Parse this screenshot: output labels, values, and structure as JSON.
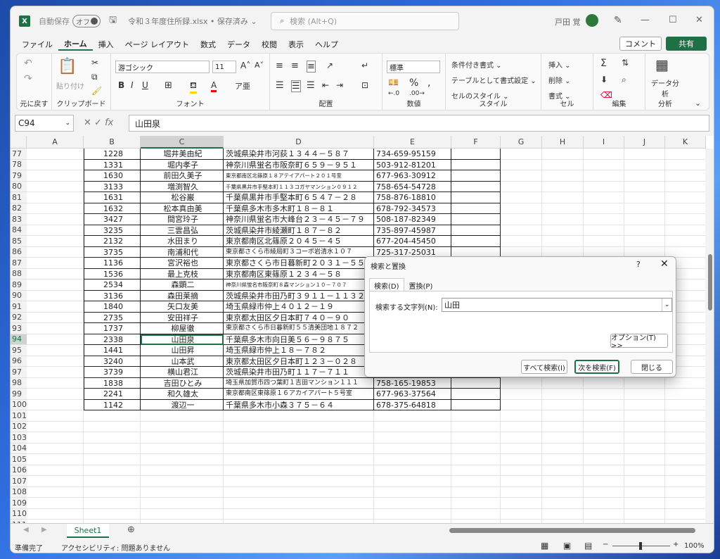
{
  "window": {
    "autosave_label": "自動保存",
    "autosave_state": "オフ",
    "doc_title": "令和３年度住所録.xlsx • 保存済み ⌄",
    "search_placeholder": "検索 (Alt+Q)",
    "user_name": "戸田 覚"
  },
  "menu": {
    "tabs": [
      "ファイル",
      "ホーム",
      "挿入",
      "ページ レイアウト",
      "数式",
      "データ",
      "校閲",
      "表示",
      "ヘルプ"
    ],
    "active": "ホーム",
    "comment": "コメント",
    "share": "共有"
  },
  "ribbon": {
    "undo_group": "元に戻す",
    "clipboard": "クリップボード",
    "paste": "貼り付け",
    "font": "フォント",
    "font_name": "游ゴシック",
    "font_size": "11",
    "alignment": "配置",
    "number": "数値",
    "number_format": "標準",
    "style": "スタイル",
    "cond_format": "条件付き書式 ⌄",
    "table_format": "テーブルとして書式設定 ⌄",
    "cell_style": "セルのスタイル ⌄",
    "cells": "セル",
    "insert": "挿入 ⌄",
    "delete": "削除 ⌄",
    "format": "書式 ⌄",
    "editing": "編集",
    "analysis": "分析",
    "data_analysis": "データ分析"
  },
  "formula_bar": {
    "name_box": "C94",
    "content": "山田泉"
  },
  "columns": [
    "A",
    "B",
    "C",
    "D",
    "E",
    "F",
    "G",
    "H",
    "I",
    "J",
    "K"
  ],
  "rows": [
    {
      "n": "77",
      "b": "1228",
      "c": "堀井美由紀",
      "d": "茨城県染井市河荻１３４４－５８７",
      "e": "734-659-95159"
    },
    {
      "n": "78",
      "b": "1331",
      "c": "堀内孝子",
      "d": "神奈川県蛍名市阪奈町６５９－９５１",
      "e": "503-912-81201"
    },
    {
      "n": "79",
      "b": "1630",
      "c": "前田久美子",
      "d": "東京都南区北篠原１８アテイアパート２０１号室",
      "e": "677-963-30912"
    },
    {
      "n": "80",
      "b": "3133",
      "c": "増渕智久",
      "d": "千葉県黒井市手堅本町１１３コガヤマンション０９１２",
      "e": "758-654-54728"
    },
    {
      "n": "81",
      "b": "1631",
      "c": "松谷巌",
      "d": "千葉県黒井市手堅本町６５４７－２８",
      "e": "758-876-18810"
    },
    {
      "n": "82",
      "b": "1632",
      "c": "松本真由美",
      "d": "千葉県多木市多木町１８－８１",
      "e": "678-792-34573"
    },
    {
      "n": "83",
      "b": "3427",
      "c": "間宮玲子",
      "d": "神奈川県蛍名市大峰台２３－４５－７９",
      "e": "508-187-82349"
    },
    {
      "n": "84",
      "b": "3235",
      "c": "三雲昌弘",
      "d": "茨城県染井市綾瀬町１８７－８２",
      "e": "735-897-45987"
    },
    {
      "n": "85",
      "b": "2132",
      "c": "水田まり",
      "d": "東京都南区北篠原２０４５－４５",
      "e": "677-204-45450"
    },
    {
      "n": "86",
      "b": "3735",
      "c": "南浦和代",
      "d": "東京都さくら市綾局町３コーポ岩清水１０７",
      "e": "725-317-25031"
    },
    {
      "n": "87",
      "b": "1136",
      "c": "宮沢裕也",
      "d": "東京都さくら市日暮新町２０３１－５５",
      "e": "5"
    },
    {
      "n": "88",
      "b": "1536",
      "c": "最上克枝",
      "d": "東京都南区東篠原１２３４－５８",
      "e": "6"
    },
    {
      "n": "89",
      "b": "2534",
      "c": "森顕二",
      "d": "神奈川県蛍名市阪奈町８森マンション１０－７０７",
      "e": "5"
    },
    {
      "n": "90",
      "b": "3136",
      "c": "森田莱摘",
      "d": "茨城県染井市田乃町３９１１－１１３２",
      "e": "7"
    },
    {
      "n": "91",
      "b": "1840",
      "c": "矢口友美",
      "d": "埼玉県緑市仲上４０１２－１９",
      "e": "7"
    },
    {
      "n": "92",
      "b": "2735",
      "c": "安田祥子",
      "d": "東京都太田区夕日本町７４０－９０",
      "e": "5"
    },
    {
      "n": "93",
      "b": "1737",
      "c": "柳屋徹",
      "d": "東京都さくら市日暮新町５５清美団地１８７２",
      "e": "7"
    },
    {
      "n": "94",
      "b": "2338",
      "c": "山田泉",
      "d": "千葉県多木市向日美５６－９８７５",
      "e": "6"
    },
    {
      "n": "95",
      "b": "1441",
      "c": "山田昇",
      "d": "埼玉県緑市仲上１８－７８２",
      "e": "7"
    },
    {
      "n": "96",
      "b": "3240",
      "c": "山本武",
      "d": "東京都太田区夕日本町１２３－０２８",
      "e": "5"
    },
    {
      "n": "97",
      "b": "3739",
      "c": "横山君江",
      "d": "茨城県染井市田乃町１１７－７１１",
      "e": "7"
    },
    {
      "n": "98",
      "b": "1838",
      "c": "吉田ひとみ",
      "d": "埼玉県加賀市四つ葉町１吉田マンション１１１",
      "e": "758-165-19853"
    },
    {
      "n": "99",
      "b": "2241",
      "c": "和久雄太",
      "d": "東京都南区東篠原１６アカイアパート５号室",
      "e": "677-963-37564"
    },
    {
      "n": "100",
      "b": "1142",
      "c": "渡辺一",
      "d": "千葉県多木市小森３７５－６４",
      "e": "678-375-64818"
    }
  ],
  "empty_rows": [
    "101",
    "102",
    "103",
    "104",
    "105",
    "106",
    "107",
    "108",
    "109",
    "110",
    "111"
  ],
  "sheet_tab": "Sheet1",
  "status": {
    "ready": "準備完了",
    "accessibility": "アクセシビリティ: 問題ありません",
    "zoom": "100%"
  },
  "dialog": {
    "title": "検索と置換",
    "help": "?",
    "tab_find": "検索(D)",
    "tab_replace": "置換(P)",
    "find_label": "検索する文字列(N):",
    "find_value": "山田",
    "options": "オプション(T) >>",
    "find_all": "すべて検索(I)",
    "find_next": "次を検索(F)",
    "close": "閉じる"
  }
}
